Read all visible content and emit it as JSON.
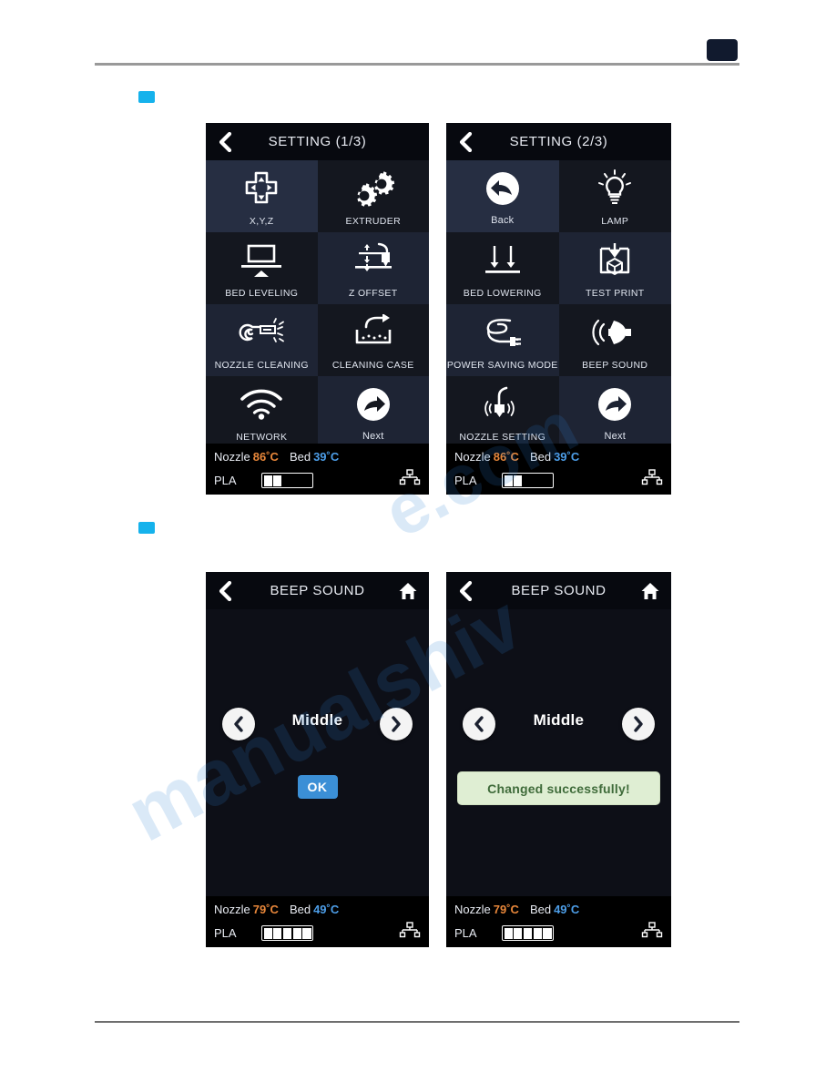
{
  "page": {
    "watermark_part1": "manualshiv",
    "watermark_part2": "e.com"
  },
  "screens": [
    {
      "id": "setting-1",
      "title": "SETTING (1/3)",
      "has_home": false,
      "tiles": [
        {
          "label": "X,Y,Z",
          "icon": "dpad-icon",
          "shade": "lite",
          "case": "upper"
        },
        {
          "label": "EXTRUDER",
          "icon": "gears-icon",
          "shade": "dark",
          "case": "upper"
        },
        {
          "label": "BED LEVELING",
          "icon": "bed-leveling-icon",
          "shade": "dark",
          "case": "upper"
        },
        {
          "label": "Z OFFSET",
          "icon": "z-offset-icon",
          "shade": "vlite",
          "case": "upper"
        },
        {
          "label": "NOZZLE CLEANING",
          "icon": "nozzle-cleaning-icon",
          "shade": "vlite",
          "case": "upper"
        },
        {
          "label": "CLEANING CASE",
          "icon": "cleaning-case-icon",
          "shade": "dark",
          "case": "upper"
        },
        {
          "label": "NETWORK",
          "icon": "wifi-icon",
          "shade": "dark",
          "case": "upper"
        },
        {
          "label": "Next",
          "icon": "next-arrow-icon",
          "shade": "vlite",
          "case": "mixed"
        }
      ],
      "status": {
        "nozzle_label": "Nozzle",
        "nozzle_temp": "86˚C",
        "bed_label": "Bed",
        "bed_temp": "39˚C",
        "material": "PLA",
        "filament_segments": 5,
        "filament_filled": 2,
        "network_icon": "lan-icon"
      }
    },
    {
      "id": "setting-2",
      "title": "SETTING (2/3)",
      "has_home": false,
      "tiles": [
        {
          "label": "Back",
          "icon": "back-arrow-icon",
          "shade": "lite",
          "case": "mixed"
        },
        {
          "label": "LAMP",
          "icon": "lamp-icon",
          "shade": "dark",
          "case": "upper"
        },
        {
          "label": "BED LOWERING",
          "icon": "bed-lowering-icon",
          "shade": "dark",
          "case": "upper"
        },
        {
          "label": "TEST PRINT",
          "icon": "test-print-icon",
          "shade": "vlite",
          "case": "upper"
        },
        {
          "label": "POWER SAVING MODE",
          "icon": "power-saving-icon",
          "shade": "vlite",
          "case": "upper"
        },
        {
          "label": "BEEP SOUND",
          "icon": "speaker-icon",
          "shade": "dark",
          "case": "upper"
        },
        {
          "label": "NOZZLE SETTING",
          "icon": "nozzle-setting-icon",
          "shade": "dark",
          "case": "upper"
        },
        {
          "label": "Next",
          "icon": "next-arrow-icon",
          "shade": "vlite",
          "case": "mixed"
        }
      ],
      "status": {
        "nozzle_label": "Nozzle",
        "nozzle_temp": "86˚C",
        "bed_label": "Bed",
        "bed_temp": "39˚C",
        "material": "PLA",
        "filament_segments": 5,
        "filament_filled": 2,
        "network_icon": "lan-icon"
      }
    },
    {
      "id": "beep-sound-select",
      "title": "BEEP SOUND",
      "has_home": true,
      "selected_value": "Middle",
      "ok_label": "OK",
      "status": {
        "nozzle_label": "Nozzle",
        "nozzle_temp": "79˚C",
        "bed_label": "Bed",
        "bed_temp": "49˚C",
        "material": "PLA",
        "filament_segments": 5,
        "filament_filled": 5,
        "network_icon": "lan-icon"
      }
    },
    {
      "id": "beep-sound-confirm",
      "title": "BEEP SOUND",
      "has_home": true,
      "selected_value": "Middle",
      "toast_message": "Changed successfully!",
      "status": {
        "nozzle_label": "Nozzle",
        "nozzle_temp": "79˚C",
        "bed_label": "Bed",
        "bed_temp": "49˚C",
        "material": "PLA",
        "filament_segments": 5,
        "filament_filled": 5,
        "network_icon": "lan-icon"
      }
    }
  ],
  "colors": {
    "accent_marker": "#15b2ec",
    "tile_light": "#262e42",
    "tile_dark": "#14171f",
    "nozzle_temp": "#e8873a",
    "bed_temp": "#4d9ee8",
    "ok_button": "#3b8fd6",
    "toast_bg": "#dfeed3",
    "toast_text": "#3f6b3a"
  }
}
